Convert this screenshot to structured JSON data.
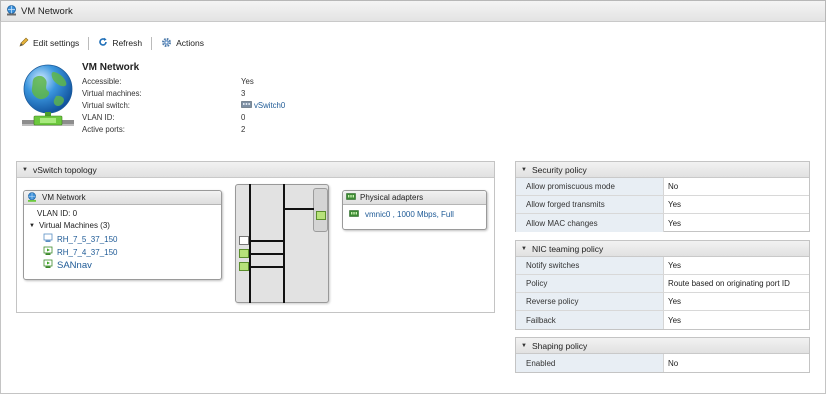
{
  "window": {
    "title": "VM Network"
  },
  "toolbar": {
    "edit_label": "Edit settings",
    "refresh_label": "Refresh",
    "actions_label": "Actions"
  },
  "summary": {
    "title": "VM Network",
    "rows": [
      {
        "label": "Accessible:",
        "value": "Yes"
      },
      {
        "label": "Virtual machines:",
        "value": "3"
      },
      {
        "label": "Virtual switch:",
        "value": "vSwitch0"
      },
      {
        "label": "VLAN ID:",
        "value": "0"
      },
      {
        "label": "Active ports:",
        "value": "2"
      }
    ]
  },
  "topology": {
    "title": "vSwitch topology",
    "portgroup": {
      "title": "VM Network",
      "vlan": "VLAN ID: 0",
      "vms_label": "Virtual Machines (3)",
      "vms": [
        "RH_7_5_37_150",
        "RH_7_4_37_150",
        "SANnav"
      ]
    },
    "physical": {
      "title": "Physical adapters",
      "nic": "vmnic0 , 1000 Mbps, Full"
    }
  },
  "security": {
    "title": "Security policy",
    "rows": [
      {
        "label": "Allow promiscuous mode",
        "value": "No"
      },
      {
        "label": "Allow forged transmits",
        "value": "Yes"
      },
      {
        "label": "Allow MAC changes",
        "value": "Yes"
      }
    ]
  },
  "nic_teaming": {
    "title": "NIC teaming policy",
    "rows": [
      {
        "label": "Notify switches",
        "value": "Yes"
      },
      {
        "label": "Policy",
        "value": "Route based on originating port ID"
      },
      {
        "label": "Reverse policy",
        "value": "Yes"
      },
      {
        "label": "Failback",
        "value": "Yes"
      }
    ]
  },
  "shaping": {
    "title": "Shaping policy",
    "rows": [
      {
        "label": "Enabled",
        "value": "No"
      }
    ]
  }
}
